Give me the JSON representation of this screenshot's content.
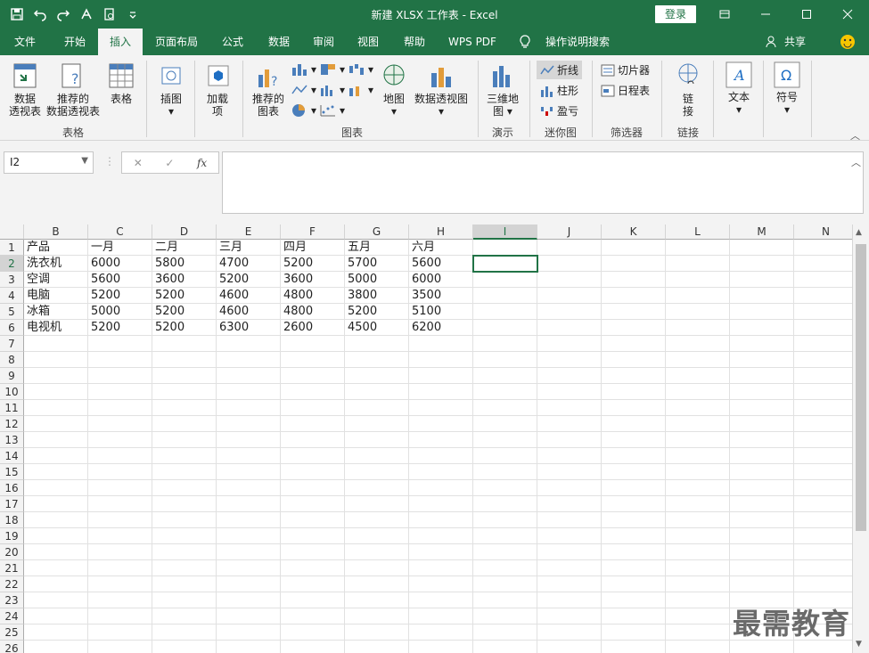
{
  "window": {
    "title": "新建 XLSX 工作表 - Excel",
    "login_label": "登录"
  },
  "tabs": [
    "文件",
    "开始",
    "插入",
    "页面布局",
    "公式",
    "数据",
    "审阅",
    "视图",
    "帮助",
    "WPS PDF",
    "操作说明搜索",
    "共享"
  ],
  "active_tab": "插入",
  "ribbon": {
    "pivot": "数据\n透视表",
    "recommended_pivot": "推荐的\n数据透视表",
    "table": "表格",
    "group_tables": "表格",
    "illustrations": "插图",
    "addins": "加载\n项",
    "recommended_charts": "推荐的\n图表",
    "maps": "地图",
    "pivot_chart": "数据透视图",
    "group_charts": "图表",
    "map3d": "三维地\n图",
    "group_tours": "演示",
    "spark_line": "折线",
    "spark_column": "柱形",
    "spark_winloss": "盈亏",
    "group_sparklines": "迷你图",
    "slicer": "切片器",
    "timeline": "日程表",
    "group_filters": "筛选器",
    "link": "链\n接",
    "group_links": "链接",
    "text": "文本",
    "symbol": "符号"
  },
  "formula_bar": {
    "name_box": "I2",
    "fx": "fx",
    "content": ""
  },
  "sheet": {
    "columns": [
      "B",
      "C",
      "D",
      "E",
      "F",
      "G",
      "H",
      "I",
      "J",
      "K",
      "L",
      "M",
      "N"
    ],
    "selected_column": "I",
    "selected_row": "2",
    "rows": [
      "1",
      "2",
      "3",
      "4",
      "5",
      "6",
      "7",
      "8",
      "9",
      "10",
      "11",
      "12",
      "13",
      "14",
      "15",
      "16",
      "17",
      "18",
      "19",
      "20",
      "21",
      "22",
      "23",
      "24",
      "25",
      "26"
    ],
    "data": [
      [
        "产品",
        "一月",
        "二月",
        "三月",
        "四月",
        "五月",
        "六月"
      ],
      [
        "洗衣机",
        "6000",
        "5800",
        "4700",
        "5200",
        "5700",
        "5600"
      ],
      [
        "空调",
        "5600",
        "3600",
        "5200",
        "3600",
        "5000",
        "6000"
      ],
      [
        "电脑",
        "5200",
        "5200",
        "4600",
        "4800",
        "3800",
        "3500"
      ],
      [
        "冰箱",
        "5000",
        "5200",
        "4600",
        "4800",
        "5200",
        "5100"
      ],
      [
        "电视机",
        "5200",
        "5200",
        "6300",
        "2600",
        "4500",
        "6200"
      ]
    ]
  },
  "watermark": "最需教育"
}
